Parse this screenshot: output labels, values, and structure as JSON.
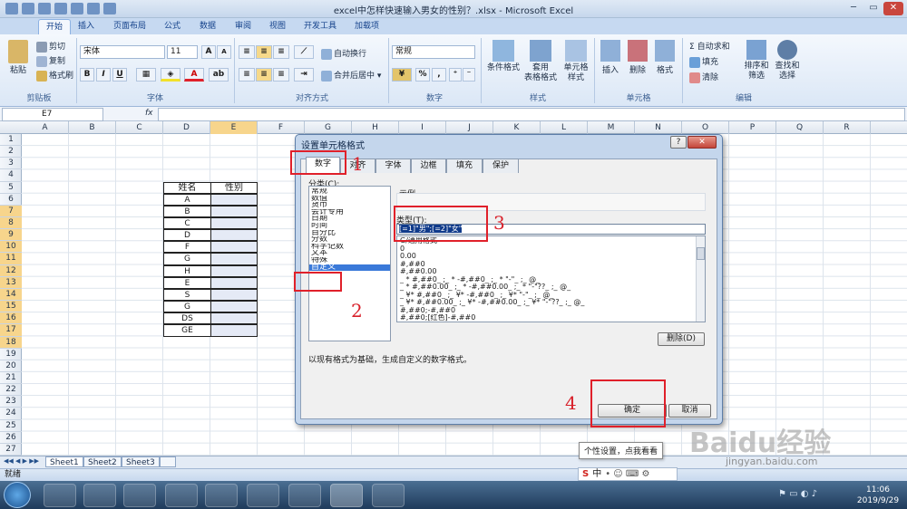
{
  "window": {
    "title": "excel中怎样快速输入男女的性别？.xlsx - Microsoft Excel"
  },
  "tabs": [
    "开始",
    "插入",
    "页面布局",
    "公式",
    "数据",
    "审阅",
    "视图",
    "开发工具",
    "加载项"
  ],
  "ribbon": {
    "clipboard": {
      "paste": "粘贴",
      "cut": "剪切",
      "copy": "复制",
      "painter": "格式刷",
      "label": "剪贴板"
    },
    "font": {
      "name": "宋体",
      "size": "11",
      "label": "字体",
      "grow": "A",
      "shrink": "A",
      "bold": "B",
      "italic": "I",
      "underline": "U"
    },
    "align": {
      "wrap": "自动换行",
      "merge": "合并后居中",
      "label": "对齐方式"
    },
    "number": {
      "format": "常规",
      "percent": "%",
      "comma": ",",
      "label": "数字"
    },
    "styles": {
      "cond": "条件格式",
      "table": "套用\n表格格式",
      "cell": "单元格\n样式",
      "label": "样式"
    },
    "cells": {
      "insert": "插入",
      "delete": "删除",
      "format": "格式",
      "label": "单元格"
    },
    "edit": {
      "sum": "自动求和",
      "fill": "填充",
      "clear": "清除",
      "sort": "排序和\n筛选",
      "find": "查找和\n选择",
      "label": "编辑"
    }
  },
  "formula_bar": {
    "cell_ref": "E7",
    "fx": "fx",
    "value": ""
  },
  "columns": [
    "A",
    "B",
    "C",
    "D",
    "E",
    "F",
    "G",
    "H",
    "I",
    "J",
    "K",
    "L",
    "M",
    "N",
    "O",
    "P",
    "Q",
    "R"
  ],
  "rows": [
    "1",
    "2",
    "3",
    "4",
    "5",
    "6",
    "7",
    "8",
    "9",
    "10",
    "11",
    "12",
    "13",
    "14",
    "15",
    "16",
    "17",
    "18",
    "19",
    "20",
    "21",
    "22",
    "23",
    "24",
    "25",
    "26",
    "27"
  ],
  "table": {
    "header": [
      "姓名",
      "性别"
    ],
    "names": [
      "A",
      "B",
      "C",
      "D",
      "F",
      "G",
      "H",
      "E",
      "S",
      "G",
      "DS",
      "GE"
    ]
  },
  "sheets": [
    "Sheet1",
    "Sheet2",
    "Sheet3"
  ],
  "status": {
    "ready": "就绪"
  },
  "dialog": {
    "title": "设置单元格格式",
    "tabs": [
      "数字",
      "对齐",
      "字体",
      "边框",
      "填充",
      "保护"
    ],
    "category_label": "分类(C):",
    "categories": [
      "常规",
      "数值",
      "货币",
      "会计专用",
      "日期",
      "时间",
      "百分比",
      "分数",
      "科学记数",
      "文本",
      "特殊",
      "自定义"
    ],
    "sample_label": "示例",
    "type_label": "类型(T):",
    "type_value": "[=1]\"男\";[=2]\"女\"",
    "formats": [
      "G/通用格式",
      "0",
      "0.00",
      "#,##0",
      "#,##0.00",
      "_ * #,##0_ ;_ * -#,##0_ ;_ * \"-\"_ ;_ @_",
      "_ * #,##0.00_ ;_ * -#,##0.00_ ;_ * \"-\"??_ ;_ @_",
      "_ ¥* #,##0_ ;_ ¥* -#,##0_ ;_ ¥* \"-\"_ ;_ @_",
      "_ ¥* #,##0.00_ ;_ ¥* -#,##0.00_ ;_ ¥* \"-\"??_ ;_ @_",
      "#,##0;-#,##0",
      "#,##0;[红色]-#,##0"
    ],
    "delete_btn": "删除(D)",
    "description": "以现有格式为基础，生成自定义的数字格式。",
    "ok": "确定",
    "cancel": "取消",
    "close": "✕",
    "help": "?"
  },
  "annotations": [
    "1",
    "2",
    "3",
    "4"
  ],
  "tooltip": "个性设置，点我看看",
  "watermark": "Baidu经验",
  "watermark_url": "jingyan.baidu.com",
  "clock": {
    "time": "11:06",
    "date": "2019/9/29"
  },
  "ime": {
    "label": "中"
  }
}
